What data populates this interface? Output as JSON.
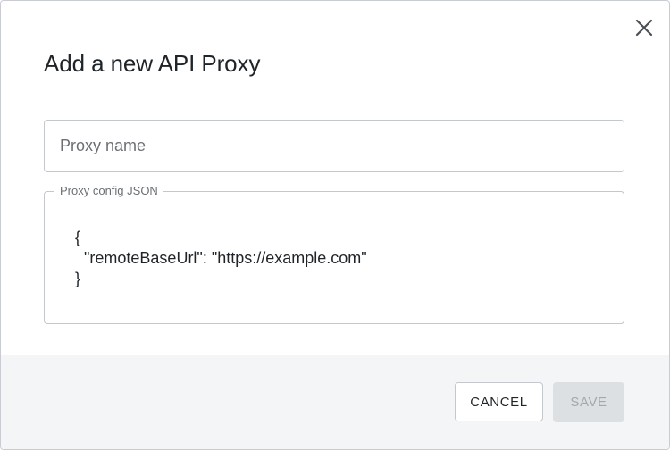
{
  "dialog": {
    "title": "Add a new API Proxy",
    "close_icon": "close-icon"
  },
  "proxy_name": {
    "value": "",
    "placeholder": "Proxy name"
  },
  "proxy_config": {
    "label": "Proxy config JSON",
    "value": "{\n  \"remoteBaseUrl\": \"https://example.com\"\n}"
  },
  "footer": {
    "cancel_label": "CANCEL",
    "save_label": "SAVE",
    "save_disabled": true
  },
  "colors": {
    "footer_background": "#f3f5f6",
    "disabled_button": "#dde0e3",
    "disabled_text": "#a3a8ad",
    "text": "#1f2428",
    "border": "#c4c7cb"
  }
}
